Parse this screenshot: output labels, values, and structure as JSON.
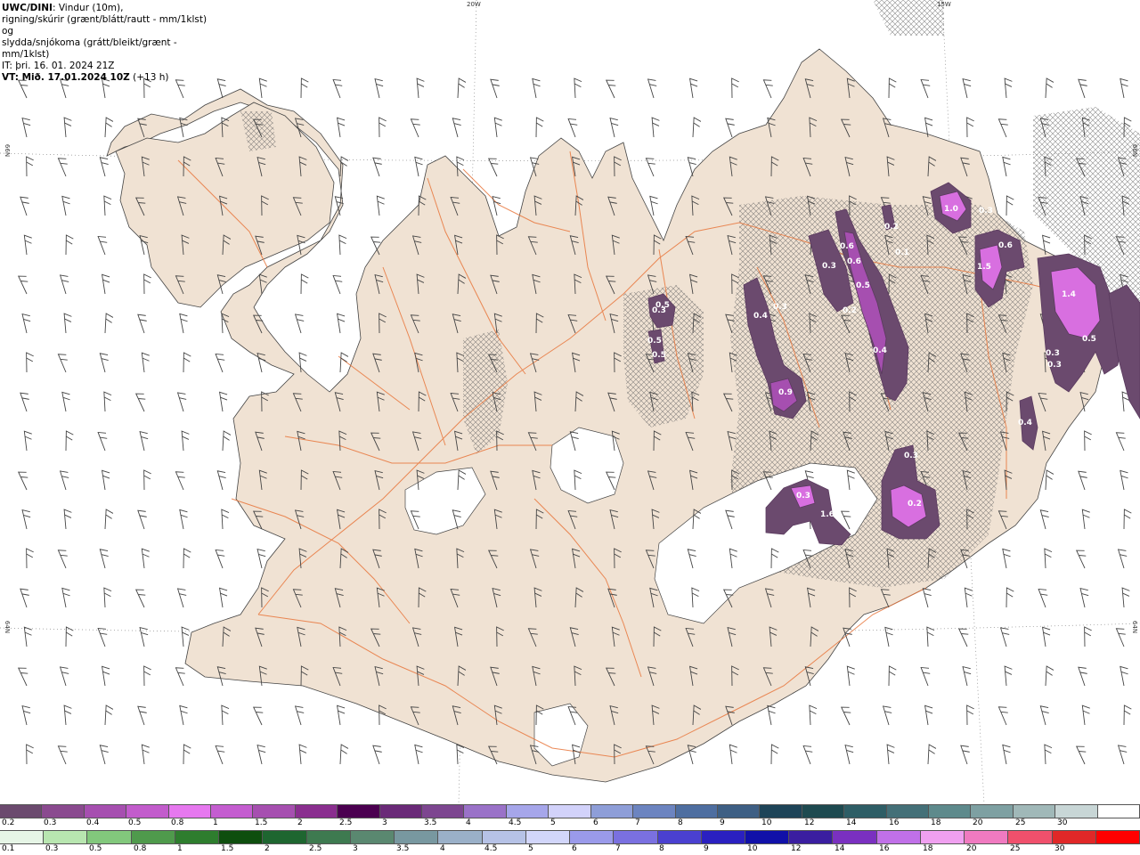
{
  "header": {
    "model": "UWC/DINI",
    "line1_rest": ": Vindur (10m),",
    "line2": "rigning/skúrir (grænt/blátt/rautt - mm/1klst) og",
    "line3": "slydda/snjókoma (grátt/bleikt/grænt - mm/1klst)",
    "line4": "IT: þri. 16. 01. 2024 21Z",
    "line5_bold": "VT: Mið. 17.01.2024 10Z",
    "line5_rest": " (+13 h)"
  },
  "grid_labels": {
    "lon_20w": "20W",
    "lon_15w": "15W",
    "lat_66n_left": "66N",
    "lat_66n_right": "66N",
    "lat_64n_left": "64N",
    "lat_64n_right": "64N"
  },
  "colors": {
    "land": "#f0e2d3",
    "sea": "#ffffff",
    "roads": "#e8763c",
    "glacier": "#ffffff",
    "snow_light": "#6b4a6e",
    "snow_medium": "#a64fb0",
    "snow_heavy": "#d86fe0"
  },
  "precip_labels": [
    "1.0",
    "0.3",
    "0.2",
    "0.6",
    "1.5",
    "0.6",
    "0.3",
    "0.6",
    "0.5",
    "0.2",
    "1.4",
    "0.5",
    "0.3",
    "0.3",
    "0.4",
    "0.3",
    "0.3",
    "0.5",
    "0.5",
    "0.5",
    "0.4",
    "0.9",
    "0.4",
    "1.6",
    "0.3",
    "0.2",
    "0.3",
    "0.1"
  ],
  "scale_top": {
    "labels": [
      "0.2",
      "0.3",
      "0.4",
      "0.5",
      "0.8",
      "1",
      "1.5",
      "2",
      "2.5",
      "3",
      "3.5",
      "4",
      "4.5",
      "5",
      "6",
      "7",
      "8",
      "9",
      "10",
      "12",
      "14",
      "16",
      "18",
      "20",
      "25",
      "30"
    ],
    "colors": [
      "#6b4a6e",
      "#8a4a8f",
      "#a64fb0",
      "#c25ccc",
      "#e678ef",
      "#c45dd0",
      "#a64fb0",
      "#8a2e8f",
      "#4b0050",
      "#6a2a78",
      "#7d4690",
      "#9a72c8",
      "#a6a6ea",
      "#d2d2fa",
      "#8e9ed8",
      "#6c84c0",
      "#4e6ea0",
      "#3e5f84",
      "#1e4458",
      "#1e4a50",
      "#2e5e66",
      "#447078",
      "#5e8a8c",
      "#7ea0a2",
      "#a0b8b8",
      "#c8d6d6",
      "#ffffff"
    ]
  },
  "scale_bottom": {
    "labels": [
      "0.1",
      "0.3",
      "0.5",
      "0.8",
      "1",
      "1.5",
      "2",
      "2.5",
      "3",
      "3.5",
      "4",
      "4.5",
      "5",
      "6",
      "7",
      "8",
      "9",
      "10",
      "12",
      "14",
      "16",
      "18",
      "20",
      "25",
      "30"
    ],
    "colors": [
      "#e6f5e6",
      "#b8e6b0",
      "#82c87c",
      "#4f9a4c",
      "#2e7d2e",
      "#0e4e0e",
      "#1e6630",
      "#3e7a50",
      "#5a8870",
      "#7898a0",
      "#9ab0c8",
      "#b6c2e6",
      "#d2d6fa",
      "#9a9aea",
      "#7a70e0",
      "#4a40d0",
      "#2a20c0",
      "#1010a8",
      "#3a1ea0",
      "#7a30c0",
      "#c070e8",
      "#f0a0f0",
      "#f07ac0",
      "#f0506c",
      "#e02828",
      "#ff0000"
    ]
  }
}
